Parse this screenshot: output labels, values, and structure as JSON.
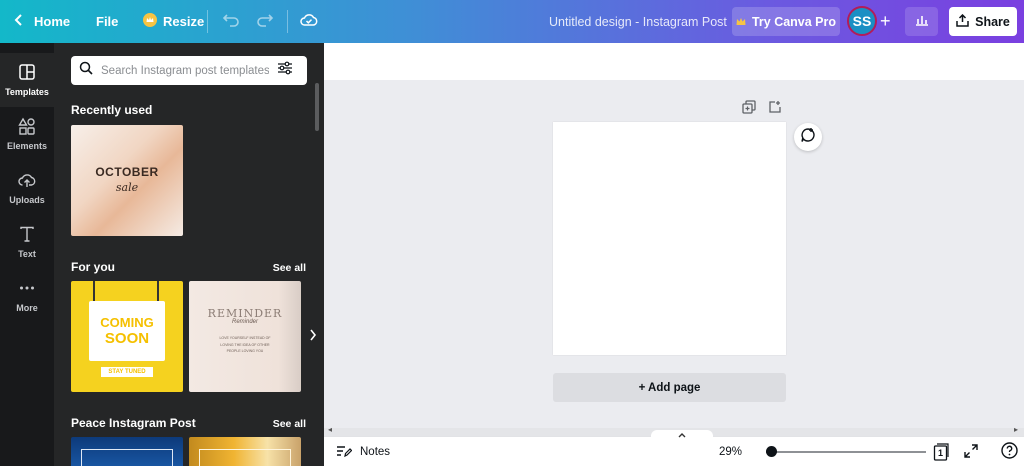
{
  "topbar": {
    "home_label": "Home",
    "file_label": "File",
    "resize_label": "Resize",
    "doc_title": "Untitled design - Instagram Post",
    "pro_label": "Try Canva Pro",
    "avatar_initials": "SS",
    "share_label": "Share"
  },
  "rail": {
    "items": [
      {
        "label": "Templates",
        "icon": "templates-icon"
      },
      {
        "label": "Elements",
        "icon": "elements-icon"
      },
      {
        "label": "Uploads",
        "icon": "uploads-icon"
      },
      {
        "label": "Text",
        "icon": "text-icon"
      },
      {
        "label": "More",
        "icon": "more-icon"
      }
    ]
  },
  "panel": {
    "search_placeholder": "Search Instagram post templates",
    "recent_title": "Recently used",
    "recent_thumb": {
      "line1": "OCTOBER",
      "line2": "sale"
    },
    "for_you_title": "For you",
    "for_you_see_all": "See all",
    "coming_soon": {
      "line1": "COMING",
      "line2": "SOON",
      "tag": "STAY TUNED"
    },
    "reminder": {
      "title": "REMINDER",
      "script": "Reminder",
      "body": "LOVE YOURSELF INSTEAD OF LOVING THE IDEA OF OTHER PEOPLE LOVING YOU"
    },
    "peace_title": "Peace Instagram Post",
    "peace_see_all": "See all"
  },
  "canvas": {
    "add_page_label": "+ Add page"
  },
  "bottombar": {
    "notes_label": "Notes",
    "zoom_value": "29%",
    "zoom_level": 0.0,
    "page_count": "1"
  },
  "colors": {
    "accent_gradient_start": "#13b8c9",
    "accent_gradient_end": "#7a3fe0",
    "panel_bg": "#252627",
    "rail_bg": "#18191b",
    "canvas_bg": "#ebecf0"
  }
}
